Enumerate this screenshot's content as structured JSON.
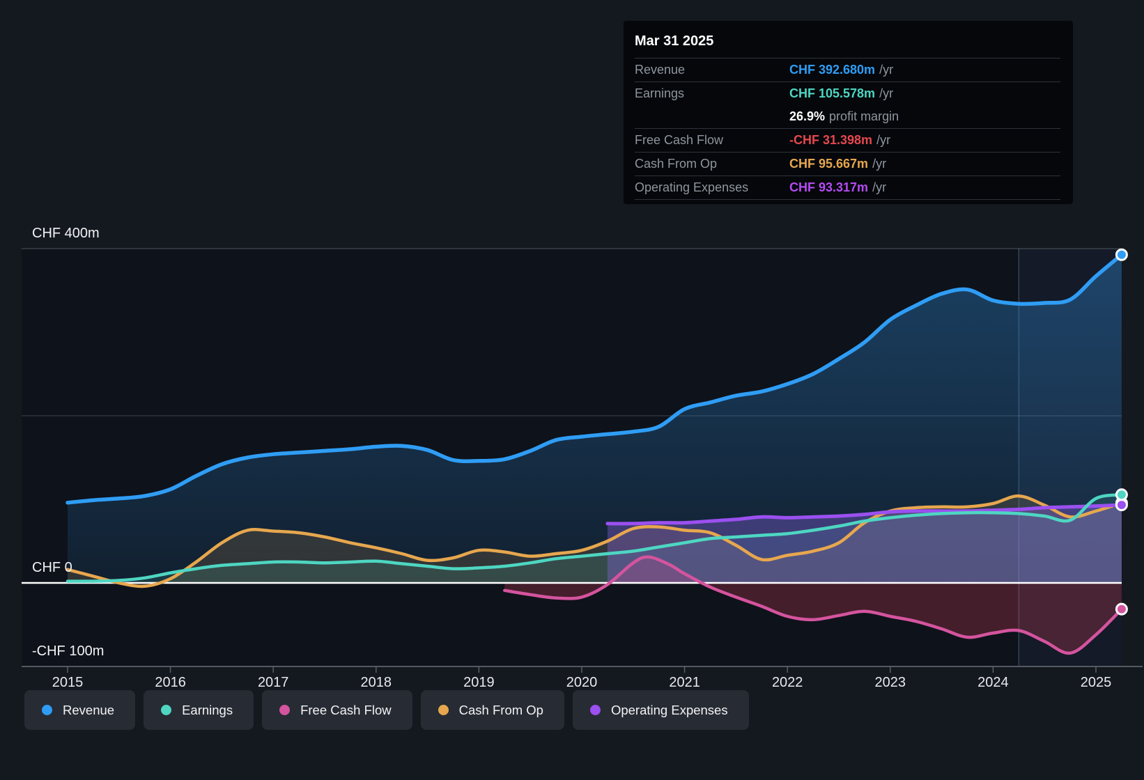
{
  "tooltip": {
    "date": "Mar 31 2025",
    "rows": [
      {
        "label": "Revenue",
        "value": "CHF 392.680m",
        "suffix": "/yr",
        "value_color": "#2f9df5"
      },
      {
        "label": "Earnings",
        "value": "CHF 105.578m",
        "suffix": "/yr",
        "value_color": "#4ed6c2"
      },
      {
        "label": "Free Cash Flow",
        "value": "-CHF 31.398m",
        "suffix": "/yr",
        "value_color": "#e5484d"
      },
      {
        "label": "Cash From Op",
        "value": "CHF 95.667m",
        "suffix": "/yr",
        "value_color": "#e7a74e"
      },
      {
        "label": "Operating Expenses",
        "value": "CHF 93.317m",
        "suffix": "/yr",
        "value_color": "#b44bf2"
      }
    ],
    "profit_margin": {
      "value": "26.9%",
      "label": "profit margin"
    }
  },
  "legend": {
    "items": [
      {
        "label": "Revenue",
        "series": "revenue"
      },
      {
        "label": "Earnings",
        "series": "earnings"
      },
      {
        "label": "Free Cash Flow",
        "series": "fcf"
      },
      {
        "label": "Cash From Op",
        "series": "cashop"
      },
      {
        "label": "Operating Expenses",
        "series": "opex"
      }
    ]
  },
  "chart_data": {
    "type": "area",
    "currency": "CHF",
    "x_domain": [
      2015,
      2025.25
    ],
    "x_ticks": [
      2015,
      2016,
      2017,
      2018,
      2019,
      2020,
      2021,
      2022,
      2023,
      2024,
      2025
    ],
    "y_ticks": [
      {
        "label": "CHF 400m",
        "value": 400
      },
      {
        "label": "CHF 0",
        "value": 0
      },
      {
        "label": "-CHF 100m",
        "value": -100
      }
    ],
    "y_gridlines": [
      400,
      200
    ],
    "highlight_from": 2024.25,
    "grid": true,
    "legend_position": "bottom",
    "series": [
      {
        "key": "revenue",
        "name": "Revenue",
        "color": "#2f9df5",
        "width": 5.5,
        "fill": "gradient",
        "points": [
          [
            2015,
            96
          ],
          [
            2015.25,
            99
          ],
          [
            2015.5,
            101
          ],
          [
            2015.75,
            104
          ],
          [
            2016,
            112
          ],
          [
            2016.25,
            128
          ],
          [
            2016.5,
            142
          ],
          [
            2016.75,
            150
          ],
          [
            2017,
            154
          ],
          [
            2017.25,
            156
          ],
          [
            2017.5,
            158
          ],
          [
            2017.75,
            160
          ],
          [
            2018,
            163
          ],
          [
            2018.25,
            164
          ],
          [
            2018.5,
            159
          ],
          [
            2018.75,
            147
          ],
          [
            2019,
            146
          ],
          [
            2019.25,
            148
          ],
          [
            2019.5,
            158
          ],
          [
            2019.75,
            171
          ],
          [
            2020,
            175
          ],
          [
            2020.25,
            178
          ],
          [
            2020.5,
            181
          ],
          [
            2020.75,
            187
          ],
          [
            2021,
            208
          ],
          [
            2021.25,
            216
          ],
          [
            2021.5,
            224
          ],
          [
            2021.75,
            229
          ],
          [
            2022,
            238
          ],
          [
            2022.25,
            250
          ],
          [
            2022.5,
            268
          ],
          [
            2022.75,
            288
          ],
          [
            2023,
            315
          ],
          [
            2023.25,
            332
          ],
          [
            2023.5,
            346
          ],
          [
            2023.75,
            351
          ],
          [
            2024,
            338
          ],
          [
            2024.25,
            334
          ],
          [
            2024.5,
            335
          ],
          [
            2024.75,
            339
          ],
          [
            2025,
            367
          ],
          [
            2025.25,
            392.68
          ]
        ]
      },
      {
        "key": "cashop",
        "name": "Cash From Op",
        "color": "#e7a74e",
        "width": 4.5,
        "fill": "rgba(231,167,78,0.15)",
        "points": [
          [
            2015,
            16
          ],
          [
            2015.25,
            8
          ],
          [
            2015.5,
            0
          ],
          [
            2015.75,
            -4
          ],
          [
            2016,
            5
          ],
          [
            2016.25,
            25
          ],
          [
            2016.5,
            48
          ],
          [
            2016.75,
            63
          ],
          [
            2017,
            62
          ],
          [
            2017.25,
            60
          ],
          [
            2017.5,
            55
          ],
          [
            2017.75,
            48
          ],
          [
            2018,
            42
          ],
          [
            2018.25,
            35
          ],
          [
            2018.5,
            27
          ],
          [
            2018.75,
            30
          ],
          [
            2019,
            39
          ],
          [
            2019.25,
            37
          ],
          [
            2019.5,
            32
          ],
          [
            2019.75,
            35
          ],
          [
            2020,
            39
          ],
          [
            2020.25,
            50
          ],
          [
            2020.5,
            65
          ],
          [
            2020.75,
            67
          ],
          [
            2021,
            63
          ],
          [
            2021.25,
            60
          ],
          [
            2021.5,
            45
          ],
          [
            2021.75,
            28
          ],
          [
            2022,
            33
          ],
          [
            2022.25,
            38
          ],
          [
            2022.5,
            48
          ],
          [
            2022.75,
            72
          ],
          [
            2023,
            86
          ],
          [
            2023.25,
            90
          ],
          [
            2023.5,
            91
          ],
          [
            2023.75,
            91
          ],
          [
            2024,
            95
          ],
          [
            2024.25,
            104
          ],
          [
            2024.5,
            93
          ],
          [
            2024.75,
            79
          ],
          [
            2025,
            86
          ],
          [
            2025.25,
            95.67
          ]
        ]
      },
      {
        "key": "earnings",
        "name": "Earnings",
        "color": "#4ed6c2",
        "width": 4.5,
        "fill": "rgba(78,214,194,0.14)",
        "points": [
          [
            2015,
            2
          ],
          [
            2015.25,
            2
          ],
          [
            2015.5,
            3
          ],
          [
            2015.75,
            6
          ],
          [
            2016,
            12
          ],
          [
            2016.25,
            17
          ],
          [
            2016.5,
            21
          ],
          [
            2016.75,
            23
          ],
          [
            2017,
            25
          ],
          [
            2017.25,
            25
          ],
          [
            2017.5,
            24
          ],
          [
            2017.75,
            25
          ],
          [
            2018,
            26
          ],
          [
            2018.25,
            23
          ],
          [
            2018.5,
            20
          ],
          [
            2018.75,
            17
          ],
          [
            2019,
            18
          ],
          [
            2019.25,
            20
          ],
          [
            2019.5,
            24
          ],
          [
            2019.75,
            29
          ],
          [
            2020,
            32
          ],
          [
            2020.25,
            35
          ],
          [
            2020.5,
            38
          ],
          [
            2020.75,
            43
          ],
          [
            2021,
            48
          ],
          [
            2021.25,
            53
          ],
          [
            2021.5,
            55
          ],
          [
            2021.75,
            57
          ],
          [
            2022,
            59
          ],
          [
            2022.25,
            63
          ],
          [
            2022.5,
            68
          ],
          [
            2022.75,
            74
          ],
          [
            2023,
            78
          ],
          [
            2023.25,
            81
          ],
          [
            2023.5,
            83
          ],
          [
            2023.75,
            84
          ],
          [
            2024,
            84
          ],
          [
            2024.25,
            83
          ],
          [
            2024.5,
            80
          ],
          [
            2024.75,
            75
          ],
          [
            2025,
            101
          ],
          [
            2025.25,
            105.58
          ]
        ]
      },
      {
        "key": "fcf",
        "name": "Free Cash Flow",
        "color": "#d4549e",
        "width": 4.5,
        "fill": "rgba(194,58,84,0.30)",
        "points": [
          [
            2019.25,
            -9
          ],
          [
            2019.5,
            -14
          ],
          [
            2019.75,
            -18
          ],
          [
            2020,
            -17
          ],
          [
            2020.25,
            -2
          ],
          [
            2020.5,
            24
          ],
          [
            2020.65,
            31
          ],
          [
            2020.85,
            22
          ],
          [
            2021,
            11
          ],
          [
            2021.25,
            -5
          ],
          [
            2021.5,
            -17
          ],
          [
            2021.75,
            -28
          ],
          [
            2022,
            -40
          ],
          [
            2022.25,
            -44
          ],
          [
            2022.5,
            -39
          ],
          [
            2022.75,
            -34
          ],
          [
            2023,
            -40
          ],
          [
            2023.25,
            -46
          ],
          [
            2023.5,
            -55
          ],
          [
            2023.75,
            -65
          ],
          [
            2024,
            -60
          ],
          [
            2024.25,
            -57
          ],
          [
            2024.5,
            -70
          ],
          [
            2024.75,
            -84
          ],
          [
            2025,
            -62
          ],
          [
            2025.25,
            -31.4
          ]
        ]
      },
      {
        "key": "opex",
        "name": "Operating Expenses",
        "color": "#9b50f0",
        "width": 5,
        "fill": "rgba(148,104,238,0.34)",
        "points": [
          [
            2020.25,
            71
          ],
          [
            2020.5,
            71
          ],
          [
            2020.75,
            72
          ],
          [
            2021,
            72
          ],
          [
            2021.25,
            74
          ],
          [
            2021.5,
            76
          ],
          [
            2021.75,
            79
          ],
          [
            2022,
            78
          ],
          [
            2022.25,
            79
          ],
          [
            2022.5,
            80
          ],
          [
            2022.75,
            82
          ],
          [
            2023,
            85
          ],
          [
            2023.25,
            86
          ],
          [
            2023.5,
            86
          ],
          [
            2023.75,
            86
          ],
          [
            2024,
            87
          ],
          [
            2024.25,
            88
          ],
          [
            2024.5,
            90
          ],
          [
            2024.75,
            91
          ],
          [
            2025,
            92
          ],
          [
            2025.25,
            93.32
          ]
        ]
      }
    ]
  }
}
